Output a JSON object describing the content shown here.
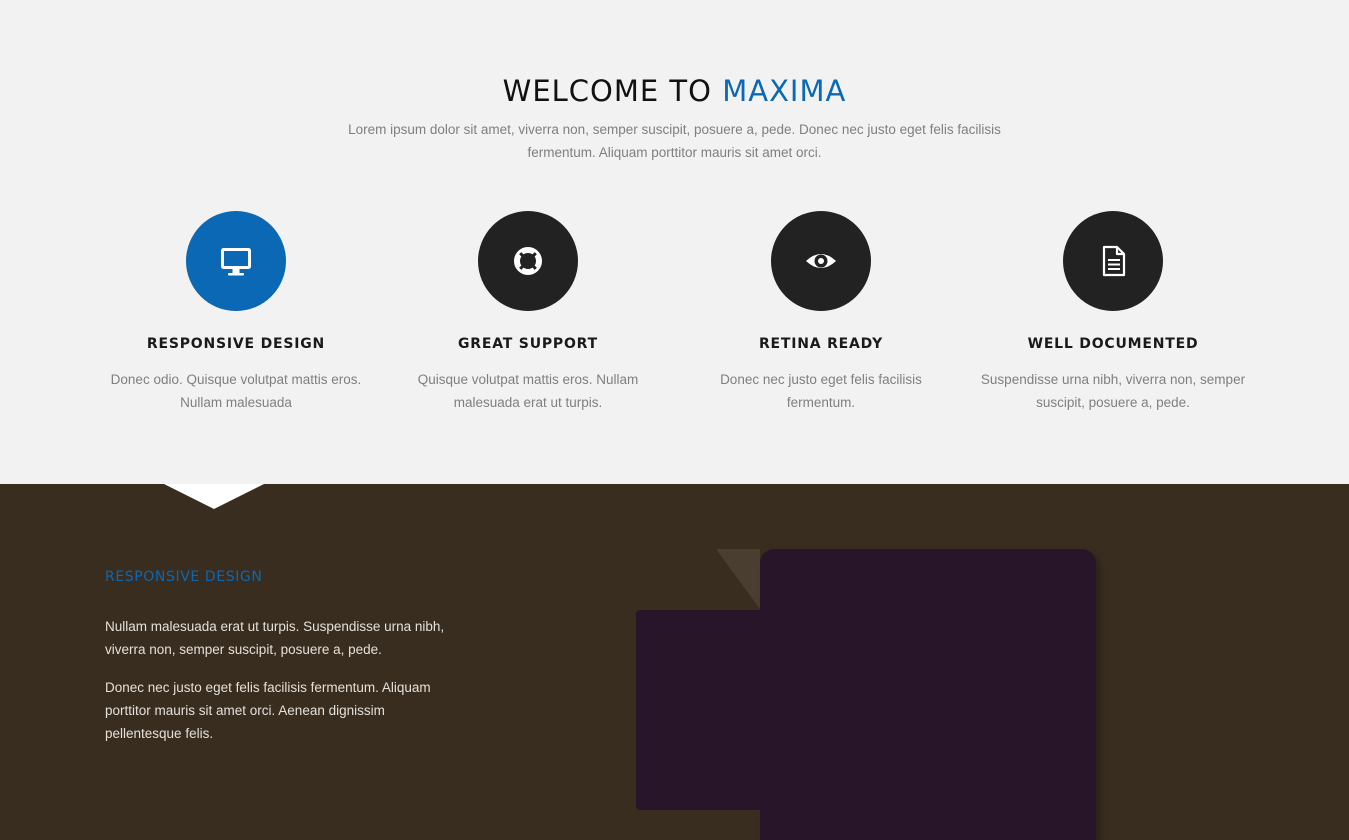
{
  "welcome": {
    "title_prefix": "WELCOME TO ",
    "title_accent": "MAXIMA",
    "description": "Lorem ipsum dolor sit amet, viverra non, semper suscipit, posuere a, pede. Donec nec justo eget felis facilisis fermentum. Aliquam porttitor mauris sit amet orci."
  },
  "features": [
    {
      "icon": "monitor-icon",
      "title": "RESPONSIVE DESIGN",
      "text": "Donec odio. Quisque volutpat mattis eros. Nullam malesuada",
      "active": true
    },
    {
      "icon": "life-ring-icon",
      "title": "GREAT SUPPORT",
      "text": "Quisque volutpat mattis eros. Nullam malesuada erat ut turpis.",
      "active": false
    },
    {
      "icon": "eye-icon",
      "title": "RETINA READY",
      "text": "Donec nec justo eget felis facilisis fermentum.",
      "active": false
    },
    {
      "icon": "document-icon",
      "title": "WELL DOCUMENTED",
      "text": "Suspendisse urna nibh, viverra non, semper suscipit, posuere a, pede.",
      "active": false
    }
  ],
  "detail": {
    "heading": "RESPONSIVE DESIGN",
    "paragraphs": [
      "Nullam malesuada erat ut turpis. Suspendisse urna nibh, viverra non, semper suscipit, posuere a, pede.",
      "Donec nec justo eget felis facilisis fermentum. Aliquam porttitor mauris sit amet orci. Aenean dignissim pellentesque felis."
    ]
  },
  "colors": {
    "accent": "#0a68b4",
    "dark_section_bg": "#392d20",
    "icon_circle": "#222222",
    "device": "#29152a"
  }
}
